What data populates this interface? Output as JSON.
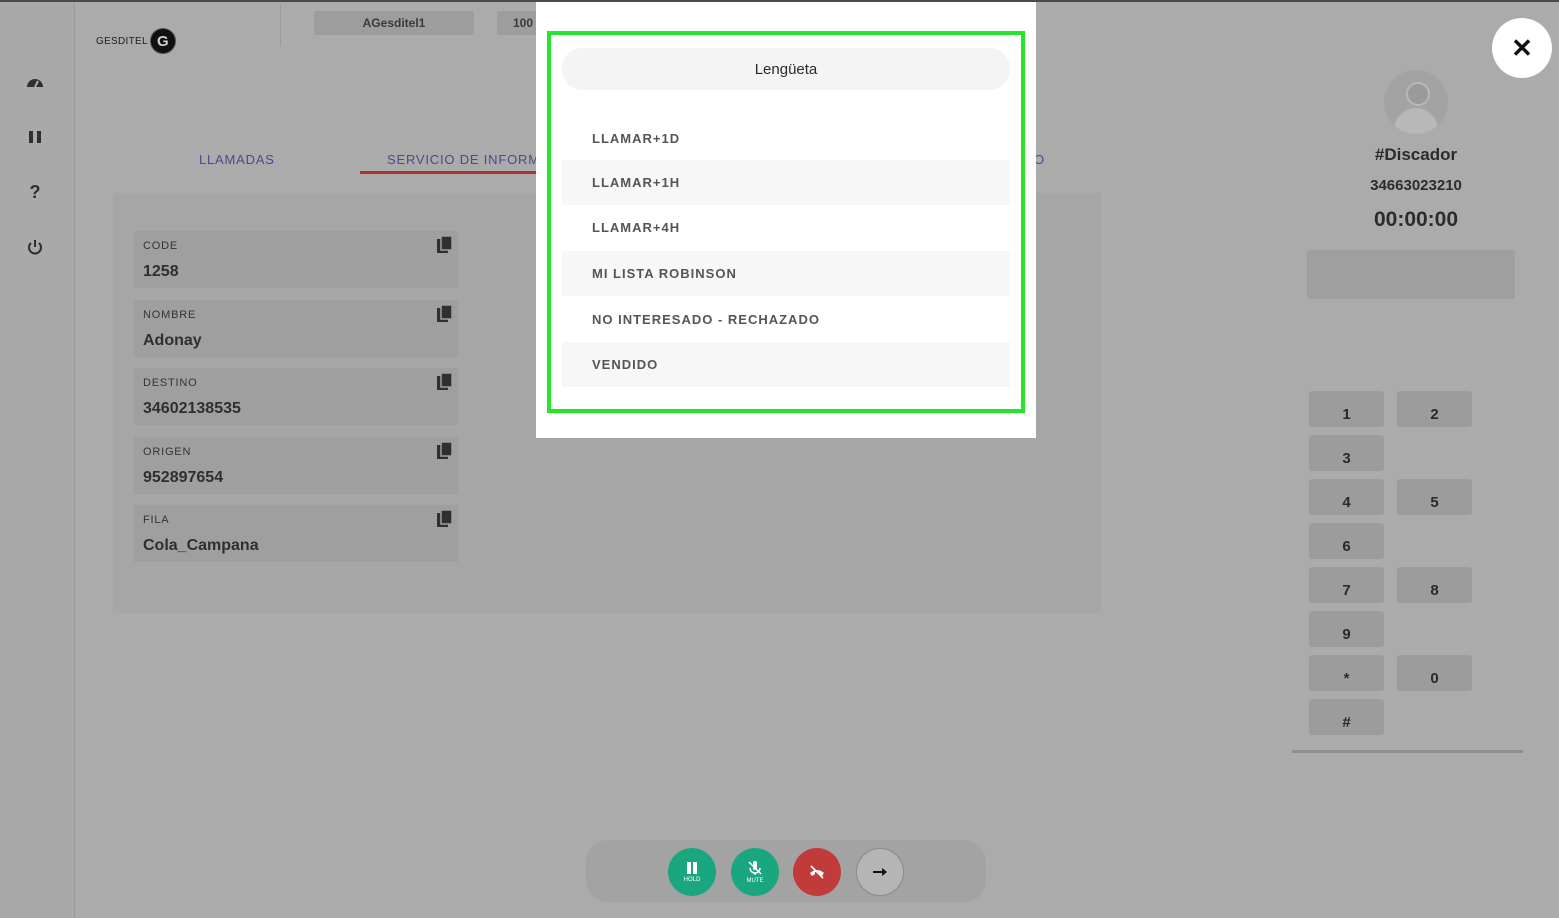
{
  "brand": {
    "name": "GESDITEL",
    "logo_letter": "G"
  },
  "header": {
    "chips": [
      "AGesditel1",
      "100"
    ]
  },
  "tabs": [
    {
      "label": "LLAMADAS"
    },
    {
      "label": "SERVICIO DE INFORM"
    },
    {
      "label": "O"
    }
  ],
  "fields": [
    {
      "label": "CODE",
      "value": "1258"
    },
    {
      "label": "NOMBRE",
      "value": "Adonay"
    },
    {
      "label": "DESTINO",
      "value": "34602138535"
    },
    {
      "label": "ORIGEN",
      "value": "952897654"
    },
    {
      "label": "FILA",
      "value": "Cola_Campana"
    }
  ],
  "agent": {
    "name": "#Discador",
    "number": "34663023210",
    "timer": "00:00:00"
  },
  "keypad": [
    "1",
    "2",
    "3",
    "4",
    "5",
    "6",
    "7",
    "8",
    "9",
    "*",
    "0",
    "#"
  ],
  "callbar": {
    "hold_label": "HOLD",
    "mute_label": "MUTE"
  },
  "modal": {
    "title": "Lengüeta",
    "options": [
      "LLAMAR+1D",
      "LLAMAR+1H",
      "LLAMAR+4H",
      "MI LISTA ROBINSON",
      "NO INTERESADO - RECHAZADO",
      "VENDIDO"
    ]
  },
  "close_glyph": "✕",
  "colors": {
    "hold": "#1aa77f",
    "mute": "#1aa77f",
    "hangup": "#c23b3b",
    "highlight": "#26e32b",
    "tab_active": "#b4302e"
  }
}
